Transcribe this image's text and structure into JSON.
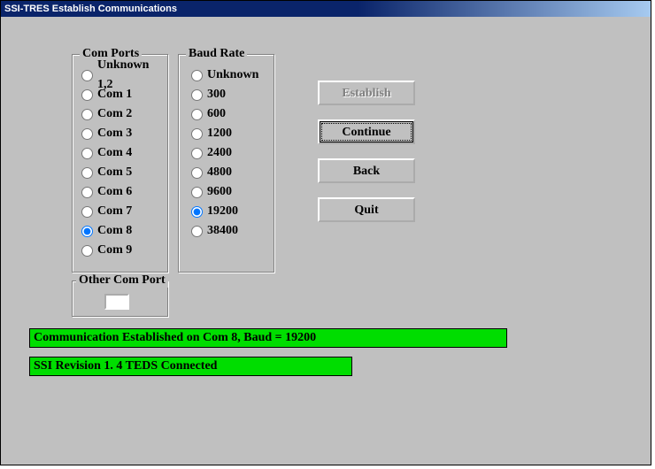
{
  "window": {
    "title": "SSI-TRES  Establish Communications"
  },
  "com_ports": {
    "legend": "Com Ports",
    "options": [
      {
        "label": "Unknown 1,2",
        "selected": false
      },
      {
        "label": "Com 1",
        "selected": false
      },
      {
        "label": "Com 2",
        "selected": false
      },
      {
        "label": "Com 3",
        "selected": false
      },
      {
        "label": "Com 4",
        "selected": false
      },
      {
        "label": "Com 5",
        "selected": false
      },
      {
        "label": "Com 6",
        "selected": false
      },
      {
        "label": "Com 7",
        "selected": false
      },
      {
        "label": "Com 8",
        "selected": true
      },
      {
        "label": "Com 9",
        "selected": false
      }
    ]
  },
  "baud": {
    "legend": "Baud Rate",
    "options": [
      {
        "label": "Unknown",
        "selected": false
      },
      {
        "label": "300",
        "selected": false
      },
      {
        "label": "600",
        "selected": false
      },
      {
        "label": "1200",
        "selected": false
      },
      {
        "label": "2400",
        "selected": false
      },
      {
        "label": "4800",
        "selected": false
      },
      {
        "label": "9600",
        "selected": false
      },
      {
        "label": "19200",
        "selected": true
      },
      {
        "label": "38400",
        "selected": false
      }
    ]
  },
  "other_com": {
    "legend": "Other Com Port",
    "value": ""
  },
  "buttons": {
    "establish": "Establish",
    "continue": "Continue",
    "back": "Back",
    "quit": "Quit"
  },
  "status": {
    "line1": "Communication Established on Com 8, Baud = 19200",
    "line2": "SSI Revision 1. 4    TEDS Connected"
  }
}
